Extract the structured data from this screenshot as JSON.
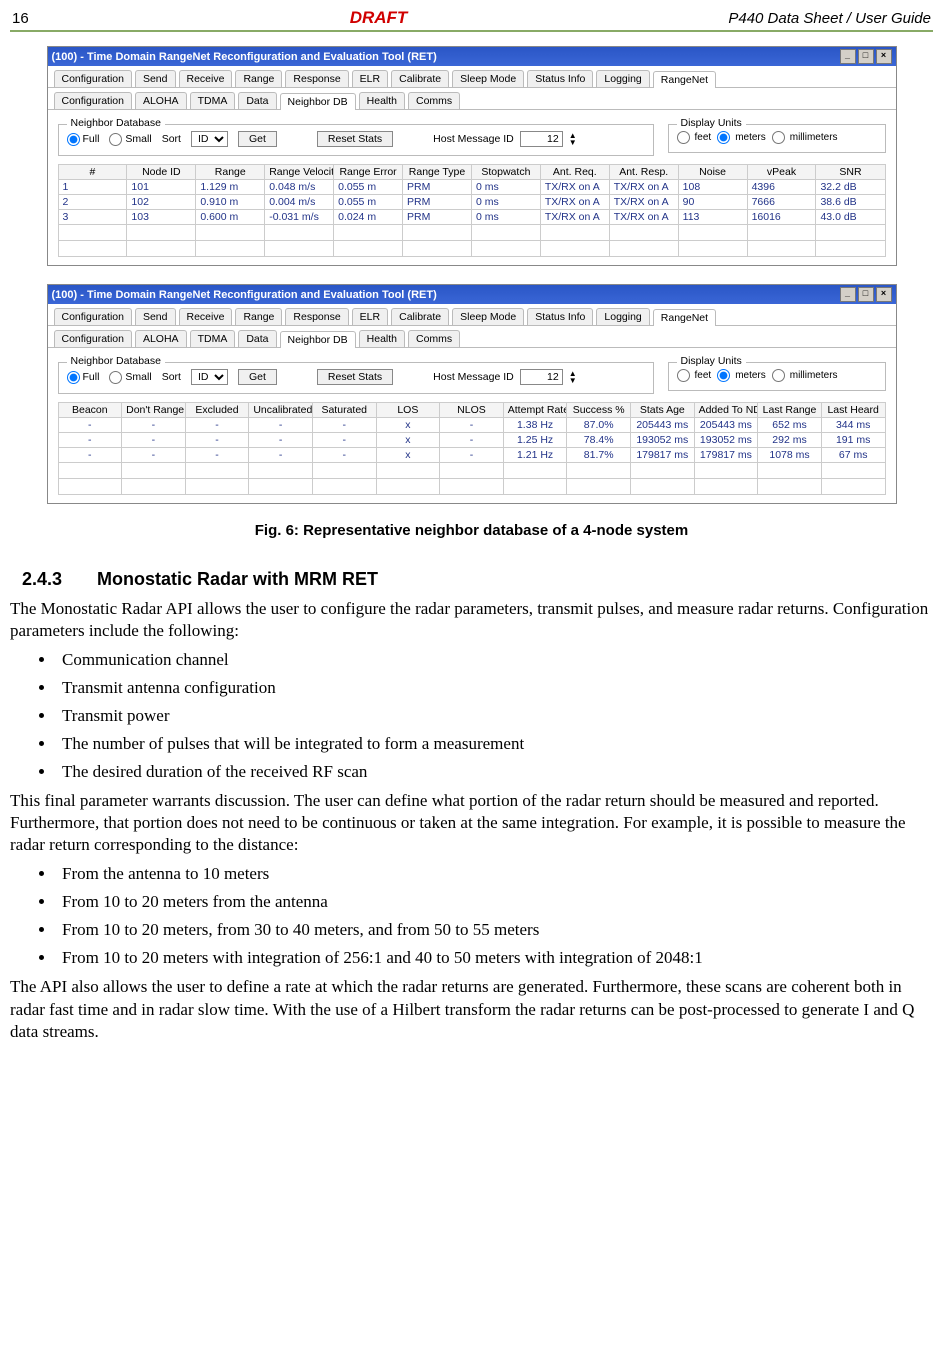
{
  "header": {
    "page_number": "16",
    "draft_label": "DRAFT",
    "doc_title": "P440 Data Sheet / User Guide"
  },
  "window_title": "(100) - Time Domain RangeNet Reconfiguration and Evaluation Tool (RET)",
  "main_tabs": [
    "Configuration",
    "Send",
    "Receive",
    "Range",
    "Response",
    "ELR",
    "Calibrate",
    "Sleep Mode",
    "Status Info",
    "Logging",
    "RangeNet"
  ],
  "sub_tabs": [
    "Configuration",
    "ALOHA",
    "TDMA",
    "Data",
    "Neighbor DB",
    "Health",
    "Comms"
  ],
  "neighdb_group": {
    "title": "Neighbor Database",
    "radio_full": "Full",
    "radio_small": "Small",
    "sort_label": "Sort",
    "sort_value": "ID",
    "get_btn": "Get",
    "reset_btn": "Reset Stats",
    "hostmsg_label": "Host Message ID",
    "hostmsg_value": "12"
  },
  "display_units": {
    "title": "Display Units",
    "feet": "feet",
    "meters": "meters",
    "millimeters": "millimeters"
  },
  "table1": {
    "headers": [
      "#",
      "Node ID",
      "Range",
      "Range Velocity",
      "Range Error",
      "Range Type",
      "Stopwatch",
      "Ant. Req.",
      "Ant. Resp.",
      "Noise",
      "vPeak",
      "SNR"
    ],
    "rows": [
      [
        "1",
        "101",
        "1.129 m",
        "0.048 m/s",
        "0.055 m",
        "PRM",
        "0 ms",
        "TX/RX on A",
        "TX/RX on A",
        "108",
        "4396",
        "32.2 dB"
      ],
      [
        "2",
        "102",
        "0.910 m",
        "0.004 m/s",
        "0.055 m",
        "PRM",
        "0 ms",
        "TX/RX on A",
        "TX/RX on A",
        "90",
        "7666",
        "38.6 dB"
      ],
      [
        "3",
        "103",
        "0.600 m",
        "-0.031 m/s",
        "0.024 m",
        "PRM",
        "0 ms",
        "TX/RX on A",
        "TX/RX on A",
        "113",
        "16016",
        "43.0 dB"
      ]
    ]
  },
  "table2": {
    "headers": [
      "Beacon",
      "Don't Range",
      "Excluded",
      "Uncalibrated",
      "Saturated",
      "LOS",
      "NLOS",
      "Attempt Rate",
      "Success %",
      "Stats Age",
      "Added To NDB",
      "Last Range",
      "Last Heard"
    ],
    "rows": [
      [
        "-",
        "-",
        "-",
        "-",
        "-",
        "x",
        "-",
        "1.38 Hz",
        "87.0%",
        "205443 ms",
        "205443 ms",
        "652 ms",
        "344 ms"
      ],
      [
        "-",
        "-",
        "-",
        "-",
        "-",
        "x",
        "-",
        "1.25 Hz",
        "78.4%",
        "193052 ms",
        "193052 ms",
        "292 ms",
        "191 ms"
      ],
      [
        "-",
        "-",
        "-",
        "-",
        "-",
        "x",
        "-",
        "1.21 Hz",
        "81.7%",
        "179817 ms",
        "179817 ms",
        "1078 ms",
        "67 ms"
      ]
    ]
  },
  "caption": "Fig. 6:  Representative neighbor database of a 4-node system",
  "section": {
    "number": "2.4.3",
    "title": "Monostatic Radar with MRM RET"
  },
  "para1": "The Monostatic Radar API allows the user to configure the radar parameters, transmit pulses, and measure radar returns. Configuration parameters include the following:",
  "bullets1": [
    "Communication channel",
    "Transmit antenna configuration",
    "Transmit power",
    "The number of pulses that will be integrated to form a measurement",
    "The desired duration of the received RF scan"
  ],
  "para2": "This final parameter warrants discussion.   The user can define what portion of the radar return should be measured and reported.  Furthermore, that portion does not need to be continuous or taken at the same integration. For example, it is possible to measure the radar return corresponding to the distance:",
  "bullets2": [
    "From the antenna to 10 meters",
    "From 10 to 20 meters from the antenna",
    "From 10 to 20 meters, from 30 to 40 meters, and from 50 to 55 meters",
    "From 10 to 20 meters with integration of 256:1 and 40 to 50 meters with integration of 2048:1"
  ],
  "para3": "The API also allows the user to define a rate at which the radar returns are generated. Furthermore, these scans are coherent both in radar fast time and in radar slow time.  With the use of a Hilbert transform the radar returns can be post-processed to generate I and Q data streams."
}
